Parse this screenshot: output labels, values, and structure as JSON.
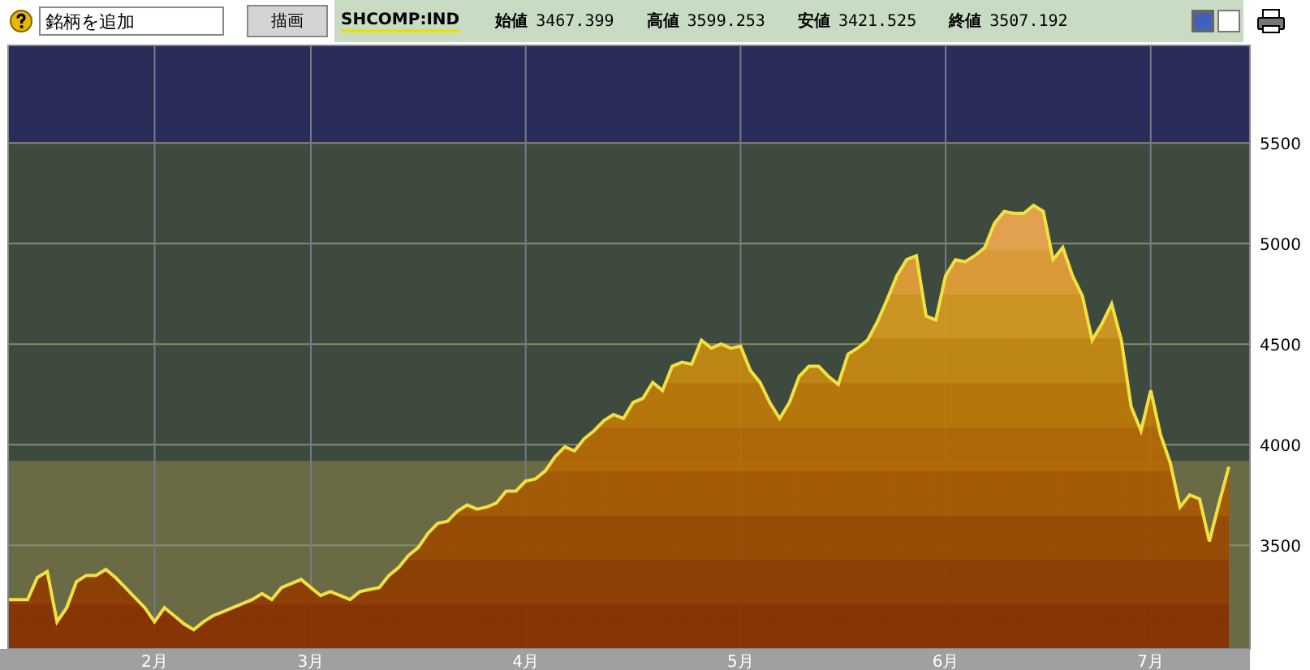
{
  "toolbar": {
    "symbol_input": {
      "value": "銘柄を追加"
    },
    "draw_button": "描画",
    "quotes": [
      {
        "label": "始値",
        "value": "3467.399"
      },
      {
        "label": "高値",
        "value": "3599.253"
      },
      {
        "label": "安値",
        "value": "3421.525"
      },
      {
        "label": "終値",
        "value": "3507.192"
      }
    ],
    "view_toggles": [
      {
        "selected": true
      },
      {
        "selected": false
      }
    ]
  },
  "chart": {
    "chart_data": {
      "type": "area",
      "ylim": [
        2985,
        5985
      ],
      "yticks": [
        3500,
        4000,
        4500,
        5000,
        5500
      ],
      "grid": true,
      "bands": [
        {
          "axis": "y",
          "from": 5500,
          "to": 5985,
          "color": "#2a2c5c"
        },
        {
          "axis": "y",
          "from": 2985,
          "to": 3920,
          "color": "#6a6a44"
        }
      ],
      "categories": [
        null,
        null,
        null,
        null,
        null,
        null,
        null,
        null,
        null,
        null,
        null,
        null,
        null,
        null,
        null,
        "2月",
        null,
        null,
        null,
        null,
        null,
        null,
        null,
        null,
        null,
        null,
        null,
        null,
        null,
        null,
        null,
        "3月",
        null,
        null,
        null,
        null,
        null,
        null,
        null,
        null,
        null,
        null,
        null,
        null,
        null,
        null,
        null,
        null,
        null,
        null,
        null,
        null,
        null,
        "4月",
        null,
        null,
        null,
        null,
        null,
        null,
        null,
        null,
        null,
        null,
        null,
        null,
        null,
        null,
        null,
        null,
        null,
        null,
        null,
        null,
        null,
        "5月",
        null,
        null,
        null,
        null,
        null,
        null,
        null,
        null,
        null,
        null,
        null,
        null,
        null,
        null,
        null,
        null,
        null,
        null,
        null,
        null,
        "6月",
        null,
        null,
        null,
        null,
        null,
        null,
        null,
        null,
        null,
        null,
        null,
        null,
        null,
        null,
        null,
        null,
        null,
        null,
        null,
        null,
        "7月",
        null,
        null,
        null,
        null,
        null,
        null,
        null,
        null
      ],
      "series": [
        {
          "name": "SHCOMP:IND",
          "color": "#f0e040",
          "values": [
            3230,
            3230,
            3230,
            3340,
            3370,
            3120,
            3190,
            3320,
            3350,
            3350,
            3380,
            3340,
            3290,
            3240,
            3190,
            3120,
            3190,
            3150,
            3110,
            3080,
            3120,
            3150,
            3170,
            3190,
            3210,
            3230,
            3260,
            3230,
            3290,
            3310,
            3330,
            3290,
            3250,
            3270,
            3250,
            3230,
            3270,
            3280,
            3290,
            3350,
            3390,
            3450,
            3490,
            3560,
            3610,
            3620,
            3670,
            3700,
            3680,
            3690,
            3710,
            3770,
            3770,
            3820,
            3830,
            3870,
            3940,
            3990,
            3970,
            4030,
            4070,
            4120,
            4150,
            4130,
            4210,
            4230,
            4310,
            4270,
            4390,
            4410,
            4400,
            4520,
            4480,
            4500,
            4480,
            4490,
            4370,
            4310,
            4210,
            4130,
            4210,
            4340,
            4390,
            4390,
            4340,
            4300,
            4450,
            4480,
            4520,
            4610,
            4720,
            4840,
            4920,
            4940,
            4640,
            4620,
            4840,
            4920,
            4910,
            4940,
            4980,
            5100,
            5160,
            5150,
            5150,
            5190,
            5160,
            4920,
            4980,
            4840,
            4740,
            4520,
            4600,
            4700,
            4520,
            4190,
            4070,
            4270,
            4050,
            3910,
            3690,
            3750,
            3730,
            3520,
            3710,
            3890
          ]
        }
      ]
    }
  }
}
